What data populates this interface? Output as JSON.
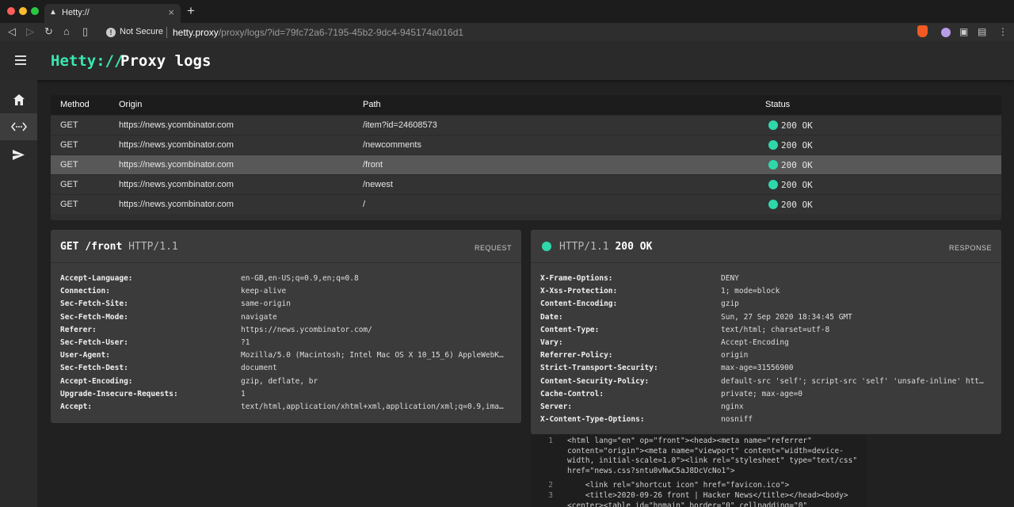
{
  "browser": {
    "tab_title": "Hetty://",
    "tab_close": "×",
    "new_tab": "+",
    "security_label": "Not Secure",
    "url_host": "hetty.proxy",
    "url_path": "/proxy/logs/?id=79fc72a6-7195-45b2-9dc4-945174a016d1",
    "traffic_colors": [
      "#fe5f57",
      "#febc2e",
      "#28c840"
    ],
    "toolbar_icons": [
      "back-icon",
      "forward-icon",
      "reload-icon",
      "home-icon",
      "bookmark-icon"
    ],
    "extension_icons": [
      "brave-shield-icon",
      "profile-icon",
      "puzzle-icon",
      "wallet-icon",
      "menu-icon"
    ]
  },
  "app": {
    "logo": "Hetty://",
    "title": "Proxy logs",
    "accent": "#39e8b0",
    "nav": [
      {
        "name": "home",
        "icon": "home-icon"
      },
      {
        "name": "proxy-logs",
        "icon": "code-arrows-icon",
        "active": true
      },
      {
        "name": "sender",
        "icon": "send-icon"
      }
    ]
  },
  "table": {
    "headers": [
      "Method",
      "Origin",
      "Path",
      "Status"
    ],
    "rows": [
      {
        "method": "GET",
        "origin": "https://news.ycombinator.com",
        "path": "/item?id=24608573",
        "status": "200 OK",
        "selected": false
      },
      {
        "method": "GET",
        "origin": "https://news.ycombinator.com",
        "path": "/newcomments",
        "status": "200 OK",
        "selected": false
      },
      {
        "method": "GET",
        "origin": "https://news.ycombinator.com",
        "path": "/front",
        "status": "200 OK",
        "selected": true
      },
      {
        "method": "GET",
        "origin": "https://news.ycombinator.com",
        "path": "/newest",
        "status": "200 OK",
        "selected": false
      },
      {
        "method": "GET",
        "origin": "https://news.ycombinator.com",
        "path": "/",
        "status": "200 OK",
        "selected": false
      }
    ]
  },
  "request": {
    "method": "GET",
    "path": "/front",
    "protocol": "HTTP/1.1",
    "tag": "REQUEST",
    "headers": [
      {
        "key": "Accept-Language:",
        "value": "en-GB,en-US;q=0.9,en;q=0.8"
      },
      {
        "key": "Connection:",
        "value": "keep-alive"
      },
      {
        "key": "Sec-Fetch-Site:",
        "value": "same-origin"
      },
      {
        "key": "Sec-Fetch-Mode:",
        "value": "navigate"
      },
      {
        "key": "Referer:",
        "value": "https://news.ycombinator.com/"
      },
      {
        "key": "Sec-Fetch-User:",
        "value": "?1"
      },
      {
        "key": "User-Agent:",
        "value": "Mozilla/5.0 (Macintosh; Intel Mac OS X 10_15_6) AppleWebKit/…"
      },
      {
        "key": "Sec-Fetch-Dest:",
        "value": "document"
      },
      {
        "key": "Accept-Encoding:",
        "value": "gzip, deflate, br"
      },
      {
        "key": "Upgrade-Insecure-Requests:",
        "value": "1"
      },
      {
        "key": "Accept:",
        "value": "text/html,application/xhtml+xml,application/xml;q=0.9,image/…"
      }
    ]
  },
  "response": {
    "protocol": "HTTP/1.1",
    "status": "200 OK",
    "tag": "RESPONSE",
    "headers": [
      {
        "key": "X-Frame-Options:",
        "value": "DENY"
      },
      {
        "key": "X-Xss-Protection:",
        "value": "1; mode=block"
      },
      {
        "key": "Content-Encoding:",
        "value": "gzip"
      },
      {
        "key": "Date:",
        "value": "Sun, 27 Sep 2020 18:34:45 GMT"
      },
      {
        "key": "Content-Type:",
        "value": "text/html; charset=utf-8"
      },
      {
        "key": "Vary:",
        "value": "Accept-Encoding"
      },
      {
        "key": "Referrer-Policy:",
        "value": "origin"
      },
      {
        "key": "Strict-Transport-Security:",
        "value": "max-age=31556900"
      },
      {
        "key": "Content-Security-Policy:",
        "value": "default-src 'self'; script-src 'self' 'unsafe-inline' https:…"
      },
      {
        "key": "Cache-Control:",
        "value": "private; max-age=0"
      },
      {
        "key": "Server:",
        "value": "nginx"
      },
      {
        "key": "X-Content-Type-Options:",
        "value": "nosniff"
      }
    ],
    "body_lines": [
      {
        "n": "1",
        "text": "<html lang=\"en\" op=\"front\"><head><meta name=\"referrer\" content=\"origin\"><meta name=\"viewport\" content=\"width=device-width, initial-scale=1.0\"><link rel=\"stylesheet\" type=\"text/css\" href=\"news.css?sntu0vNwC5aJ8DcVcNo1\">"
      },
      {
        "n": "2",
        "text": "    <link rel=\"shortcut icon\" href=\"favicon.ico\">"
      },
      {
        "n": "3",
        "text": "    <title>2020-09-26 front | Hacker News</title></head><body><center><table id=\"hnmain\" border=\"0\" cellpadding=\"0\""
      }
    ]
  }
}
